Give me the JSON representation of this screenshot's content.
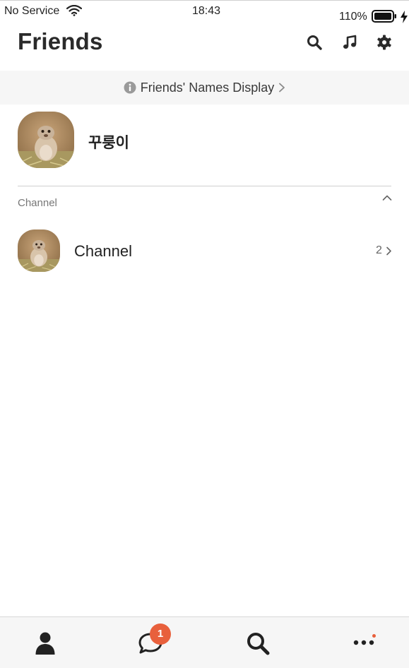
{
  "status": {
    "carrier": "No Service",
    "time": "18:43",
    "battery": "110%"
  },
  "header": {
    "title": "Friends",
    "icons": [
      "search-icon",
      "music-note-icon",
      "gear-icon"
    ]
  },
  "notice": {
    "label": "Friends' Names Display"
  },
  "profile": {
    "name": "꾸룽이"
  },
  "channel_section": {
    "label": "Channel",
    "items": [
      {
        "name": "Channel",
        "count": "2"
      }
    ]
  },
  "tabbar": {
    "tabs": [
      "friends-tab",
      "chats-tab",
      "search-tab",
      "more-tab"
    ],
    "chat_badge": "1"
  },
  "colors": {
    "accent": "#e8603c",
    "background": "#ffffff",
    "bar_gray": "#f6f6f6",
    "text": "#2b2b2b"
  }
}
